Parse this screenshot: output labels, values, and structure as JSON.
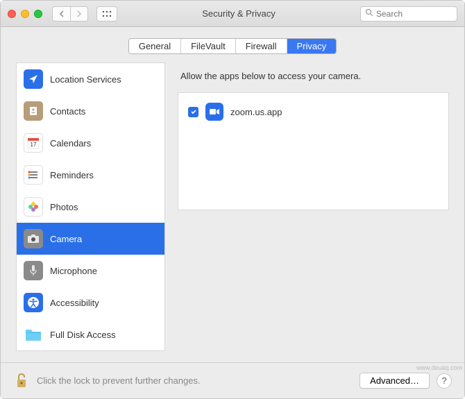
{
  "window": {
    "title": "Security & Privacy"
  },
  "search": {
    "placeholder": "Search"
  },
  "tabs": [
    {
      "label": "General",
      "active": false
    },
    {
      "label": "FileVault",
      "active": false
    },
    {
      "label": "Firewall",
      "active": false
    },
    {
      "label": "Privacy",
      "active": true
    }
  ],
  "sidebar": {
    "items": [
      {
        "label": "Location Services",
        "icon": "location",
        "bg": "#2a6fe8"
      },
      {
        "label": "Contacts",
        "icon": "contacts",
        "bg": "#b6a07a"
      },
      {
        "label": "Calendars",
        "icon": "calendar",
        "bg": "#ffffff"
      },
      {
        "label": "Reminders",
        "icon": "reminders",
        "bg": "#ffffff"
      },
      {
        "label": "Photos",
        "icon": "photos",
        "bg": "#ffffff"
      },
      {
        "label": "Camera",
        "icon": "camera",
        "bg": "#8a8a8a",
        "selected": true
      },
      {
        "label": "Microphone",
        "icon": "microphone",
        "bg": "#8a8a8a"
      },
      {
        "label": "Accessibility",
        "icon": "accessibility",
        "bg": "#2a6fe8"
      },
      {
        "label": "Full Disk Access",
        "icon": "folder",
        "bg": "#5ac8fa"
      }
    ]
  },
  "main": {
    "description": "Allow the apps below to access your camera.",
    "apps": [
      {
        "name": "zoom.us.app",
        "checked": true,
        "icon": "video"
      }
    ]
  },
  "footer": {
    "lock_text": "Click the lock to prevent further changes.",
    "advanced_label": "Advanced…",
    "help_label": "?"
  },
  "watermark": "www.deuaq.com"
}
